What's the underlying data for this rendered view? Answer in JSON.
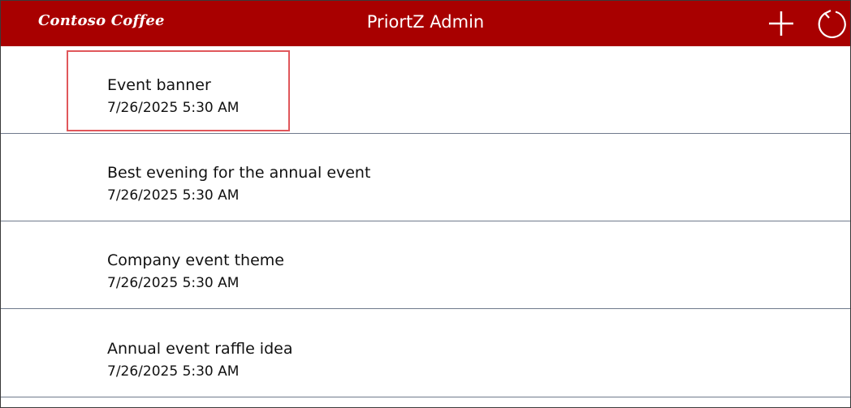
{
  "app": {
    "logo_text": "Contoso Coffee",
    "title": "PriortZ Admin"
  },
  "header": {
    "add_icon": "plus-icon",
    "refresh_icon": "refresh-icon",
    "background_color": "#a80000"
  },
  "items": [
    {
      "title": "Event banner",
      "date": "7/26/2025 5:30 AM"
    },
    {
      "title": "Best evening for the annual event",
      "date": "7/26/2025 5:30 AM"
    },
    {
      "title": "Company event theme",
      "date": "7/26/2025 5:30 AM"
    },
    {
      "title": "Annual event raffle idea",
      "date": "7/26/2025 5:30 AM"
    }
  ],
  "highlight_color": "#e0575b"
}
